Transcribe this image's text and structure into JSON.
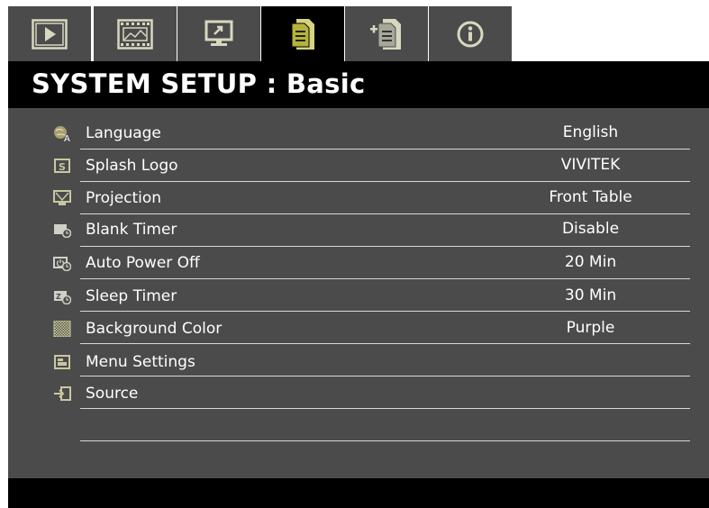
{
  "tabs": [
    {
      "icon": "picture-icon"
    },
    {
      "icon": "film-icon"
    },
    {
      "icon": "display-icon"
    },
    {
      "icon": "system-setup-basic-icon",
      "active": true
    },
    {
      "icon": "system-setup-advanced-icon"
    },
    {
      "icon": "information-icon"
    }
  ],
  "title": "SYSTEM SETUP : Basic",
  "menu": [
    {
      "label": "Language",
      "value": "English",
      "icon": "globe-icon"
    },
    {
      "label": "Splash Logo",
      "value": "VIVITEK",
      "icon": "splash-logo-icon"
    },
    {
      "label": "Projection",
      "value": "Front Table",
      "icon": "projection-icon"
    },
    {
      "label": "Blank Timer",
      "value": "Disable",
      "icon": "blank-timer-icon"
    },
    {
      "label": "Auto Power Off",
      "value": "20 Min",
      "icon": "auto-power-off-icon"
    },
    {
      "label": "Sleep Timer",
      "value": "30 Min",
      "icon": "sleep-timer-icon"
    },
    {
      "label": "Background Color",
      "value": "Purple",
      "icon": "background-color-icon"
    },
    {
      "label": "Menu Settings",
      "value": "",
      "icon": "menu-settings-icon"
    },
    {
      "label": "Source",
      "value": "",
      "icon": "source-icon"
    }
  ],
  "colors": {
    "panel": "#4b4b4b",
    "bar": "#000000",
    "text": "#ffffff",
    "icon": "#c8c8a0"
  }
}
